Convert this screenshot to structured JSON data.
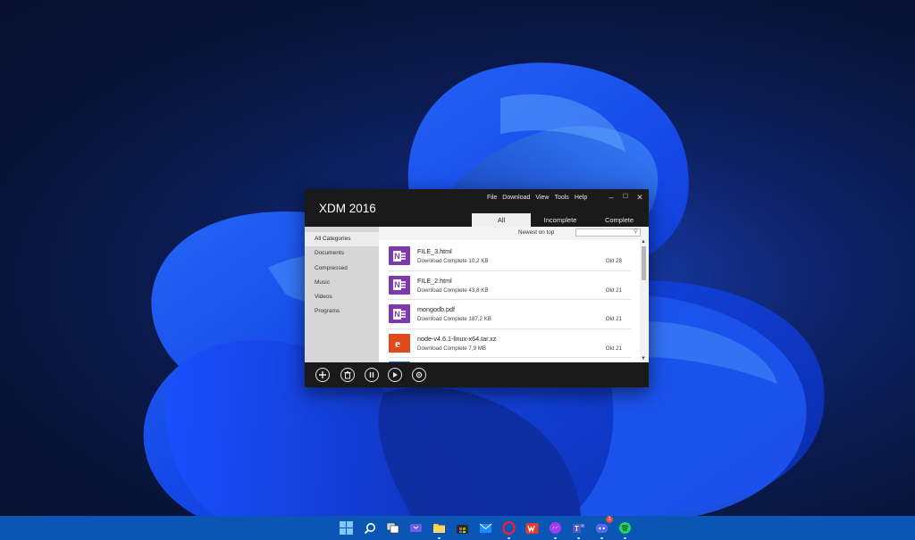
{
  "window": {
    "title": "XDM 2016",
    "menu": [
      "File",
      "Download",
      "View",
      "Tools",
      "Help"
    ],
    "controls": {
      "minimize": "–",
      "maximize": "☐",
      "close": "✕"
    },
    "tabs": [
      {
        "label": "All",
        "active": true
      },
      {
        "label": "Incomplete",
        "active": false
      },
      {
        "label": "Complete",
        "active": false
      }
    ]
  },
  "sidebar": {
    "items": [
      {
        "label": "All Categories",
        "active": true
      },
      {
        "label": "Documents"
      },
      {
        "label": "Compressed"
      },
      {
        "label": "Music"
      },
      {
        "label": "Videos"
      },
      {
        "label": "Programs"
      }
    ]
  },
  "list_header": {
    "sort_label": "Newest on top",
    "search_placeholder": "",
    "search_icon": "search-icon"
  },
  "downloads": [
    {
      "name": "FILE_3.html",
      "status": "Download Complete 10,2 KB",
      "date": "Okt 28",
      "icon": "onenote-icon"
    },
    {
      "name": "FILE_2.html",
      "status": "Download Complete 43,8 KB",
      "date": "Okt 21",
      "icon": "onenote-icon"
    },
    {
      "name": "mongodb.pdf",
      "status": "Download Complete 187,2 KB",
      "date": "Okt 21",
      "icon": "onenote-icon"
    },
    {
      "name": "node-v4.6.1-linux-x64.tar.xz",
      "status": "Download Complete 7,9 MB",
      "date": "Okt 21",
      "icon": "ie-icon"
    }
  ],
  "bottom_toolbar": [
    "add-icon",
    "delete-icon",
    "pause-icon",
    "resume-icon",
    "settings-icon"
  ],
  "taskbar": {
    "icons": [
      "windows-start-icon",
      "search-icon",
      "task-view-icon",
      "chat-icon",
      "file-explorer-icon",
      "store-icon",
      "mail-icon",
      "opera-icon",
      "wps-icon",
      "messenger-icon",
      "teams-icon",
      "discord-icon",
      "spotify-icon"
    ],
    "discord_badge": "1"
  },
  "colors": {
    "window_bg": "#1a1a1a",
    "sidebar_bg": "#d6d6d6",
    "taskbar": "#0b56b5",
    "onenote": "#7c3aad",
    "ie": "#e04a1a"
  }
}
